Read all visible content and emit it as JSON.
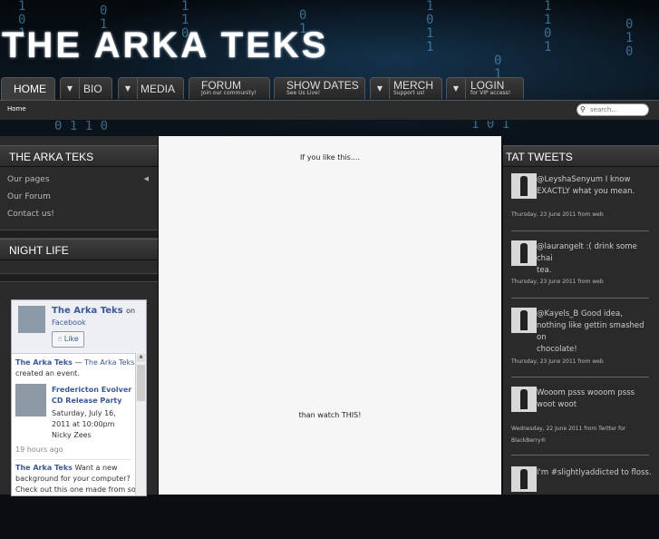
{
  "header": {
    "logo": "THE ARKA TEKS"
  },
  "nav": {
    "tabs": [
      {
        "label": "HOME",
        "sub": ""
      },
      {
        "label": "BIO",
        "sub": ""
      },
      {
        "label": "MEDIA",
        "sub": ""
      },
      {
        "label": "FORUM",
        "sub": "Join our community!"
      },
      {
        "label": "SHOW DATES",
        "sub": "See Us Live!"
      },
      {
        "label": "MERCH",
        "sub": "Support us!"
      },
      {
        "label": "LOGIN",
        "sub": "for VIP access!"
      }
    ],
    "breadcrumb": "Home",
    "search_placeholder": "search..."
  },
  "left": {
    "title": "THE ARKA TEKS",
    "menu": [
      "Our pages",
      "Our Forum",
      "Contact us!"
    ],
    "nightlife_title": "NIGHT LIFE"
  },
  "facebook": {
    "page_name": "The Arka Teks",
    "on": "on",
    "facebook": "Facebook",
    "like": "Like",
    "post1_author": "The Arka Teks",
    "post1_dash": "—",
    "post1_target": "The Arka Teks",
    "post1_action": "created an event.",
    "event_title_1": "Fredericton Evolver",
    "event_title_2": "CD Release Party",
    "event_date_1": "Saturday, July 16,",
    "event_date_2": "2011 at 10:00pm",
    "event_place": "Nicky Zees",
    "post1_time": "19 hours ago",
    "post2_author": "The Arka Teks",
    "post2_text_1": "Want a new",
    "post2_text_2": "background for your computer?",
    "post2_text_3": "Check out this one made from some"
  },
  "center": {
    "top_text": "If you like this....",
    "bottom_text": "than watch THIS!"
  },
  "tweets": {
    "title": "TAT TWEETS",
    "items": [
      {
        "line1": "@LeyshaSenyum I know",
        "line2": "EXACTLY what you mean.",
        "line3": "",
        "meta1": "Thursday, 23 June 2011 from web",
        "meta2": ""
      },
      {
        "line1": "@laurangelt :( drink some chai",
        "line2": "tea.",
        "line3": "",
        "meta1": "Thursday, 23 June 2011 from web",
        "meta2": ""
      },
      {
        "line1": "@Kayels_B Good idea,",
        "line2": "nothing like gettin smashed on",
        "line3": "chocolate!",
        "meta1": "Thursday, 23 June 2011 from web",
        "meta2": ""
      },
      {
        "line1": "Wooom psss wooom psss",
        "line2": "woot woot",
        "line3": "",
        "meta1": "Wednesday, 22 June 2011 from Twitter for",
        "meta2": "BlackBerry®"
      },
      {
        "line1": "I'm #slightlyaddicted to floss.",
        "line2": "",
        "line3": "",
        "meta1": "",
        "meta2": ""
      }
    ]
  }
}
